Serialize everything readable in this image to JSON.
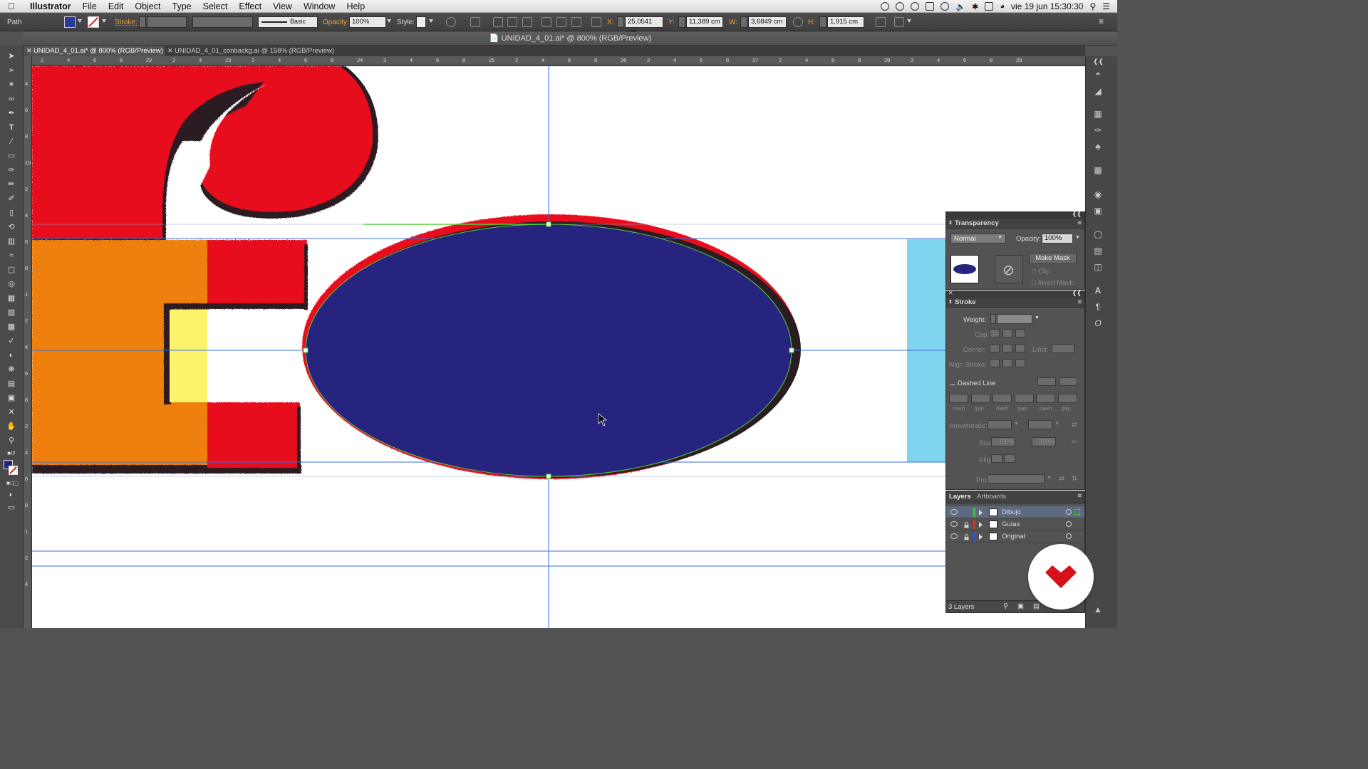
{
  "menubar": {
    "app": "Illustrator",
    "menus": [
      "File",
      "Edit",
      "Object",
      "Type",
      "Select",
      "Effect",
      "View",
      "Window",
      "Help"
    ],
    "clock": "vie 19 jun  15:30:30"
  },
  "control": {
    "selection": "Path",
    "stroke_label": "Stroke:",
    "brush": "Basic",
    "opacity_label": "Opacity:",
    "opacity": "100%",
    "style_label": "Style:",
    "x_label": "X:",
    "x": "25,0541 cm",
    "y_label": "Y:",
    "y": "11,389 cm",
    "w_label": "W:",
    "w": "3,6849 cm",
    "h_label": "H:",
    "h": "1,915 cm"
  },
  "window": {
    "title": "UNIDAD_4_01.ai* @ 800% (RGB/Preview)"
  },
  "tabs": [
    {
      "label": "UNIDAD_4_01.ai* @ 800% (RGB/Preview)"
    },
    {
      "label": "UNIDAD_4_01_conbackg.ai @ 158% (RGB/Preview)"
    }
  ],
  "ruler_top": [
    "2",
    "4",
    "6",
    "8",
    "22",
    "2",
    "4",
    "23",
    "2",
    "4",
    "6",
    "8",
    "24",
    "2",
    "4",
    "6",
    "8",
    "25",
    "2",
    "4",
    "6",
    "8",
    "26",
    "2",
    "4",
    "6",
    "8",
    "27",
    "2",
    "4",
    "6",
    "8",
    "28",
    "2",
    "4",
    "6",
    "8",
    "29"
  ],
  "ruler_left": [
    "4",
    "6",
    "8",
    "10",
    "2",
    "4",
    "6",
    "8",
    "1",
    "2",
    "4",
    "6",
    "8",
    "2",
    "4",
    "6",
    "8",
    "1",
    "2",
    "4"
  ],
  "transparency": {
    "title": "Transparency",
    "mode": "Normal",
    "opacity_label": "Opacity:",
    "opacity": "100%",
    "make_mask": "Make Mask",
    "clip": "Clip",
    "invert_mask": "Invert Mask"
  },
  "stroke_panel": {
    "title": "Stroke",
    "weight": "Weight:",
    "cap": "Cap:",
    "corner": "Corner:",
    "limit": "Limit:",
    "align": "Align Stroke:",
    "dashed": "Dashed Line",
    "dash_labels": [
      "dash",
      "gap",
      "dash",
      "gap",
      "dash",
      "gap"
    ],
    "arrowheads": "Arrowheads:",
    "scale": "Scale:",
    "scale_val": "100%",
    "align2": "Align:",
    "profile": "Profile:"
  },
  "layers_panel": {
    "tabs": [
      "Layers",
      "Artboards"
    ],
    "layers": [
      {
        "name": "Dibujo",
        "color": "#3cc83c"
      },
      {
        "name": "Guías",
        "color": "#e03030"
      },
      {
        "name": "Original",
        "color": "#3050e0"
      }
    ],
    "count": "3 Layers"
  },
  "colors": {
    "ellipse_fill": "#272480",
    "red": "#e8101c",
    "orange": "#f08010",
    "yellow": "#fbf36a",
    "cyan": "#7fd4f0",
    "guide": "#3a6fd8",
    "selection": "#5acd3c"
  }
}
